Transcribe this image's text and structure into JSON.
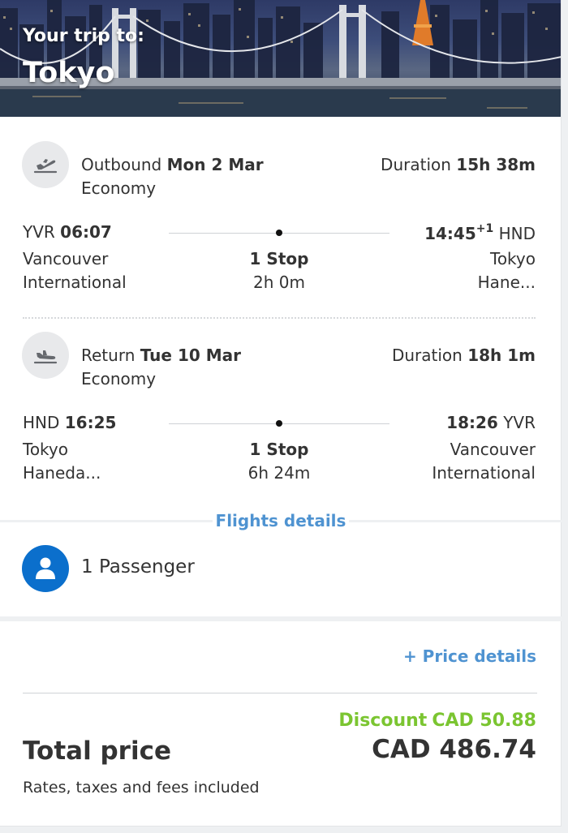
{
  "hero": {
    "subtitle": "Your trip to:",
    "destination": "Tokyo"
  },
  "outbound": {
    "label": "Outbound",
    "date": "Mon 2 Mar",
    "cabin": "Economy",
    "duration_label": "Duration",
    "duration": "15h 38m",
    "dep_code": "YVR",
    "dep_time": "06:07",
    "dep_city": "Vancouver",
    "dep_airport": "International",
    "arr_time": "14:45",
    "arr_day_offset": "+1",
    "arr_code": "HND",
    "arr_city": "Tokyo",
    "arr_airport": "Hane...",
    "stops": "1 Stop",
    "layover": "2h 0m",
    "icon": "plane-takeoff-icon"
  },
  "return": {
    "label": "Return",
    "date": "Tue 10 Mar",
    "cabin": "Economy",
    "duration_label": "Duration",
    "duration": "18h 1m",
    "dep_code": "HND",
    "dep_time": "16:25",
    "dep_city": "Tokyo",
    "dep_airport": "Haneda...",
    "arr_time": "18:26",
    "arr_code": "YVR",
    "arr_city": "Vancouver",
    "arr_airport": "International",
    "stops": "1 Stop",
    "layover": "6h 24m",
    "icon": "plane-landing-icon"
  },
  "flight_details_link": "Flights details",
  "passenger": {
    "label": "1 Passenger",
    "icon": "user-icon"
  },
  "price": {
    "details_link": "+ Price details",
    "discount_label": "Discount",
    "discount_value": "CAD 50.88",
    "total_label": "Total price",
    "total_value": "CAD 486.74",
    "note": "Rates, taxes and fees included"
  },
  "colors": {
    "link": "#4f93d1",
    "discount": "#7bc531",
    "avatar": "#0b6fcc"
  }
}
